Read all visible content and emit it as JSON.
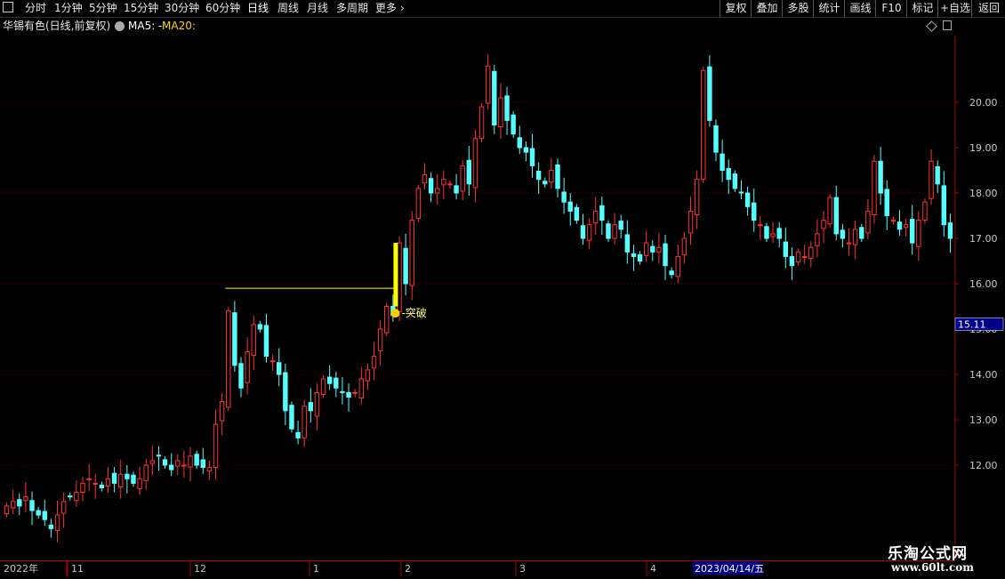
{
  "toolbar": {
    "left_items": [
      "分时",
      "1分钟",
      "5分钟",
      "15分钟",
      "30分钟",
      "60分钟",
      "日线",
      "周线",
      "月线",
      "多周期",
      "更多"
    ],
    "active_item": "日线",
    "more_chevron": "›",
    "right_items": [
      "复权",
      "叠加",
      "多股",
      "统计",
      "画线",
      "F10",
      "标记",
      "+自选",
      "返回"
    ]
  },
  "info": {
    "stock_title": "华锡有色(日线,前复权)",
    "ma5": "MA5: -",
    "ma20": "MA20:"
  },
  "price_axis": {
    "ticks": [
      "20.00",
      "19.00",
      "18.00",
      "17.00",
      "16.00",
      "15.00",
      "14.00",
      "13.00",
      "12.00"
    ],
    "current_price": "15.11"
  },
  "annotation": {
    "label": "突破"
  },
  "date_axis": {
    "year_label": "2022年",
    "month_labels": [
      "11",
      "12",
      "1",
      "2",
      "3",
      "4"
    ],
    "cursor_date": "2023/04/14/五"
  },
  "watermark": {
    "title": "乐淘公式网",
    "url": "www.60lt.com"
  },
  "colors": {
    "up": "#ff3232",
    "down": "#54ffff",
    "grid": "#7a0000",
    "highlight": "#ffff00",
    "axis_text": "#c8c8c8"
  },
  "chart_data": {
    "type": "candlestick",
    "ylim": [
      11.0,
      21.5
    ],
    "close": [
      11.1,
      11.2,
      11.1,
      11.3,
      11.0,
      10.9,
      10.8,
      10.6,
      10.9,
      11.2,
      11.3,
      11.4,
      11.6,
      11.7,
      11.6,
      11.5,
      11.7,
      11.6,
      11.8,
      11.7,
      11.6,
      11.7,
      12.0,
      12.1,
      12.2,
      12.0,
      11.9,
      12.1,
      12.0,
      12.2,
      12.0,
      11.95,
      11.95,
      12.9,
      13.4,
      15.4,
      14.2,
      13.7,
      14.5,
      15.1,
      15.0,
      14.4,
      14.3,
      14.0,
      13.2,
      12.8,
      12.6,
      13.3,
      13.2,
      13.6,
      13.9,
      13.8,
      13.7,
      13.6,
      13.5,
      13.6,
      13.9,
      14.1,
      14.4,
      15.0,
      15.5,
      15.3,
      16.9,
      16.0,
      17.4,
      18.1,
      18.4,
      18.0,
      18.1,
      18.3,
      18.2,
      18.0,
      18.6,
      18.2,
      19.2,
      19.9,
      20.8,
      19.5,
      20.1,
      19.6,
      19.3,
      19.0,
      18.9,
      18.6,
      18.3,
      18.2,
      18.5,
      18.1,
      17.8,
      17.6,
      17.4,
      17.0,
      17.3,
      17.6,
      17.4,
      17.0,
      17.3,
      17.2,
      16.7,
      16.6,
      16.5,
      16.9,
      16.7,
      16.8,
      16.4,
      16.2,
      16.6,
      17.0,
      17.6,
      18.3,
      20.7,
      19.6,
      18.9,
      18.5,
      18.3,
      18.1,
      18.0,
      17.7,
      17.4,
      17.3,
      17.0,
      17.1,
      17.0,
      16.6,
      16.4,
      16.7,
      16.6,
      16.8,
      17.1,
      17.4,
      17.9,
      17.1,
      17.0,
      16.9,
      17.2,
      17.0,
      17.6,
      18.7,
      18.0,
      17.5,
      17.4,
      17.2,
      17.3,
      16.9,
      17.4,
      17.8,
      18.7,
      18.2,
      17.3,
      17.0
    ]
  }
}
